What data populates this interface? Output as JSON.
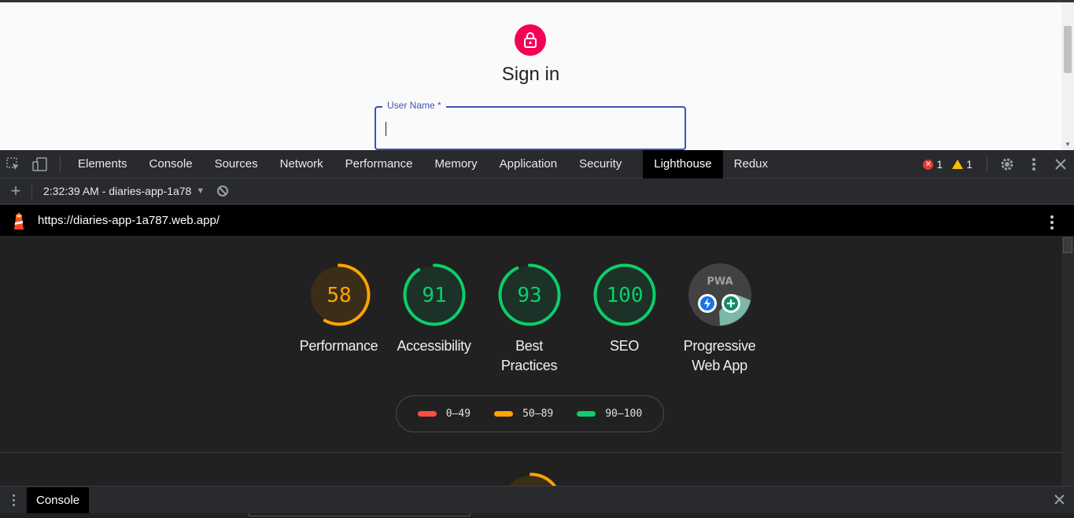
{
  "page": {
    "title": "Sign in",
    "username_label": "User Name *",
    "username_value": ""
  },
  "devtools": {
    "tabs": [
      {
        "label": "Elements",
        "active": false
      },
      {
        "label": "Console",
        "active": false
      },
      {
        "label": "Sources",
        "active": false
      },
      {
        "label": "Network",
        "active": false
      },
      {
        "label": "Performance",
        "active": false
      },
      {
        "label": "Memory",
        "active": false
      },
      {
        "label": "Application",
        "active": false
      },
      {
        "label": "Security",
        "active": false
      },
      {
        "label": "Lighthouse",
        "active": true
      },
      {
        "label": "Redux",
        "active": false
      }
    ],
    "errors": "1",
    "warnings": "1"
  },
  "lighthouse": {
    "report_name": "2:32:39 AM - diaries-app-1a78",
    "url": "https://diaries-app-1a787.web.app/",
    "scores": [
      {
        "score": 58,
        "label": "Performance",
        "color": "#ffa400",
        "bg": "#3b2e18"
      },
      {
        "score": 91,
        "label": "Accessibility",
        "color": "#0cce6b",
        "bg": "#1c3127"
      },
      {
        "score": 93,
        "label": "Best Practices",
        "color": "#0cce6b",
        "bg": "#1c3127"
      },
      {
        "score": 100,
        "label": "SEO",
        "color": "#0cce6b",
        "bg": "#1c3127"
      }
    ],
    "pwa": {
      "label": "Progressive Web App",
      "badge": "PWA"
    },
    "legend": [
      {
        "range": "0–49",
        "color": "#ff4e42"
      },
      {
        "range": "50–89",
        "color": "#ffa400"
      },
      {
        "range": "90–100",
        "color": "#0cce6b"
      }
    ]
  },
  "drawer": {
    "tab": "Console"
  }
}
